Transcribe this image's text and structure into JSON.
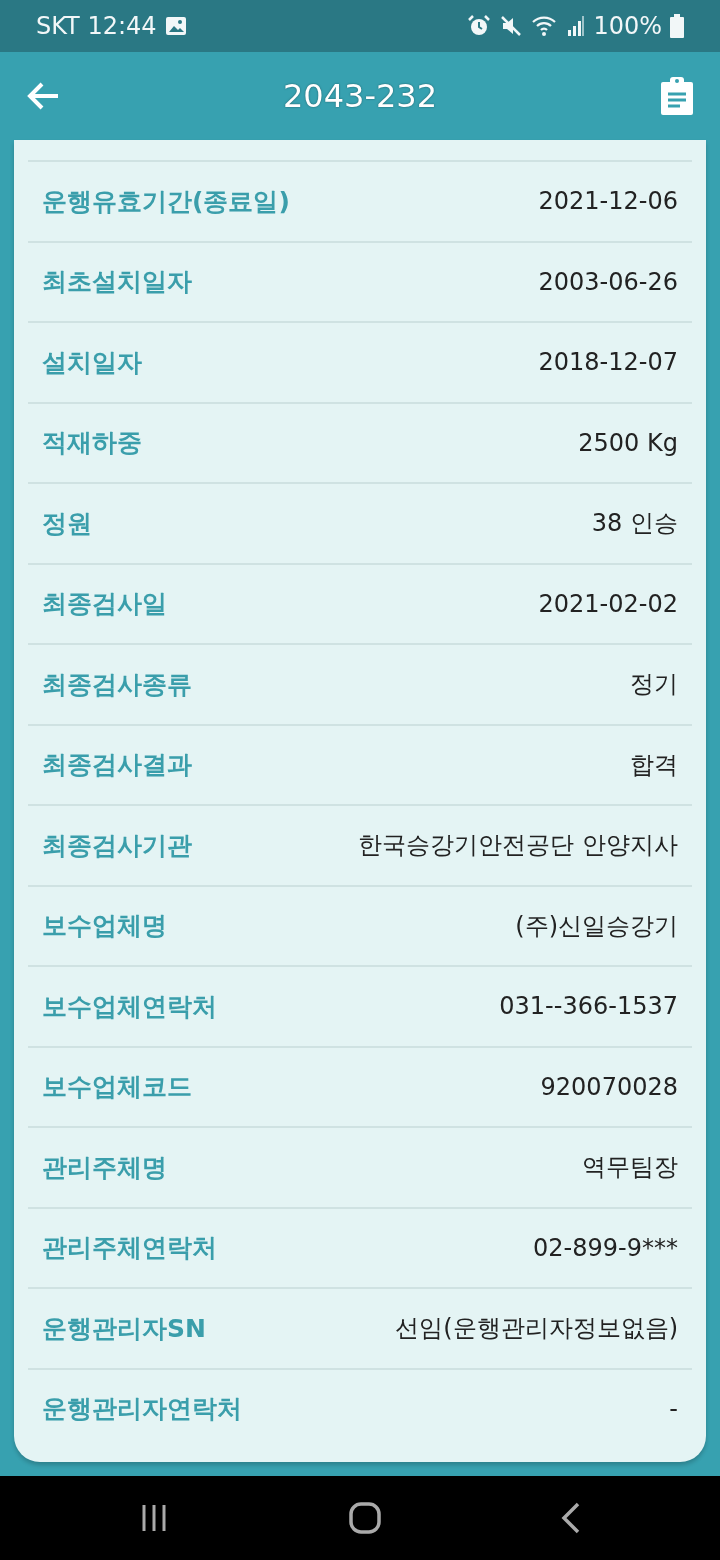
{
  "status_bar": {
    "carrier_time": "SKT 12:44",
    "battery": "100%"
  },
  "header": {
    "title": "2043-232"
  },
  "rows": [
    {
      "label": "운행유효기간(종료일)",
      "value": "2021-12-06"
    },
    {
      "label": "최초설치일자",
      "value": "2003-06-26"
    },
    {
      "label": "설치일자",
      "value": "2018-12-07"
    },
    {
      "label": "적재하중",
      "value": "2500 Kg"
    },
    {
      "label": "정원",
      "value": "38 인승"
    },
    {
      "label": "최종검사일",
      "value": "2021-02-02"
    },
    {
      "label": "최종검사종류",
      "value": "정기"
    },
    {
      "label": "최종검사결과",
      "value": "합격"
    },
    {
      "label": "최종검사기관",
      "value": "한국승강기안전공단 안양지사"
    },
    {
      "label": "보수업체명",
      "value": "(주)신일승강기"
    },
    {
      "label": "보수업체연락처",
      "value": "031--366-1537"
    },
    {
      "label": "보수업체코드",
      "value": "920070028"
    },
    {
      "label": "관리주체명",
      "value": "역무팀장"
    },
    {
      "label": "관리주체연락처",
      "value": "02-899-9***"
    },
    {
      "label": "운행관리자SN",
      "value": "선임(운행관리자정보없음)"
    },
    {
      "label": "운행관리자연락처",
      "value": "-"
    }
  ]
}
